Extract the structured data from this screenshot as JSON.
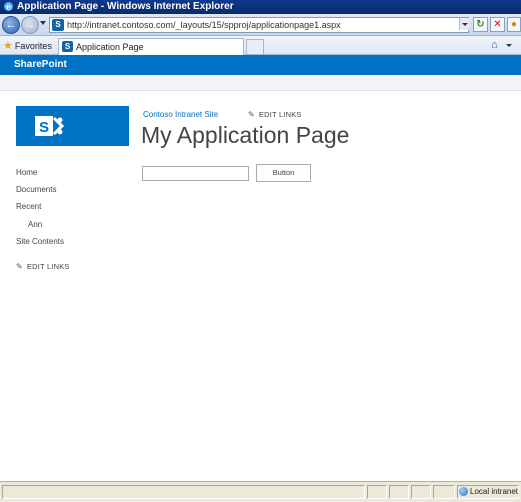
{
  "window": {
    "title": "Application Page - Windows Internet Explorer",
    "address_url": "http://intranet.contoso.com/_layouts/15/spproj/applicationpage1.aspx"
  },
  "favorites_bar": {
    "favorites_label": "Favorites",
    "tab_label": "Application Page"
  },
  "suite_bar": {
    "brand": "SharePoint"
  },
  "header": {
    "site_link": "Contoso Intranet Site",
    "edit_links": "EDIT LINKS",
    "page_title": "My Application Page"
  },
  "form": {
    "text_value": "",
    "button_label": "Button"
  },
  "left_nav": {
    "items": [
      {
        "label": "Home"
      },
      {
        "label": "Documents"
      },
      {
        "label": "Recent"
      },
      {
        "label": "Ann"
      },
      {
        "label": "Site Contents"
      }
    ],
    "edit_links": "EDIT LINKS"
  },
  "status_bar": {
    "zone": "Local intranet"
  },
  "colors": {
    "brand_blue": "#0072c6",
    "titlebar": "#0c3a8c"
  }
}
